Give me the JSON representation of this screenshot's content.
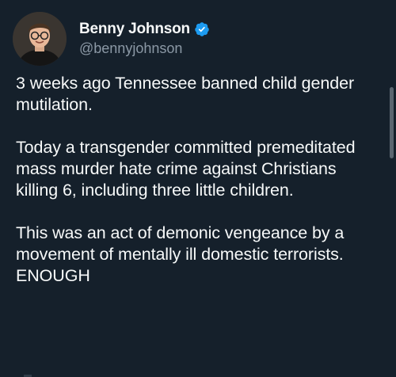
{
  "author": {
    "display_name": "Benny Johnson",
    "handle": "@bennyjohnson",
    "verified": true,
    "avatar_icon": "profile-photo",
    "verified_icon": "verified-badge-icon"
  },
  "tweet": {
    "paragraphs": [
      "3 weeks ago Tennessee banned child gender mutilation.",
      "Today a transgender committed premeditated mass murder hate crime against Christians killing 6, including three little children.",
      "This was an act of demonic vengeance by a movement of mentally ill domestic terrorists. ENOUGH"
    ]
  },
  "colors": {
    "background": "#15202b",
    "text": "#f7f9f9",
    "secondary_text": "#8b98a5",
    "verified_blue": "#1d9bf0"
  }
}
